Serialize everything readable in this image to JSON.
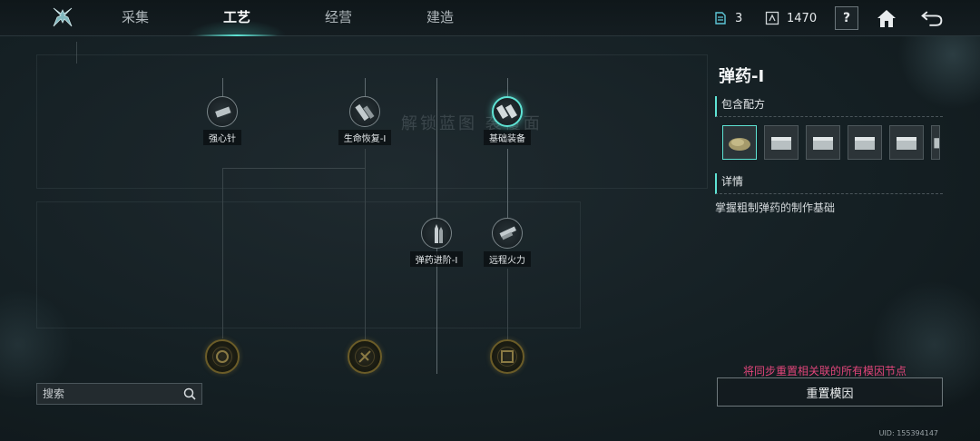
{
  "tabs": [
    {
      "label": "采集"
    },
    {
      "label": "工艺"
    },
    {
      "label": "经营"
    },
    {
      "label": "建造"
    }
  ],
  "resources": {
    "blueprint_count": "3",
    "currency": "1470"
  },
  "help_label": "?",
  "tree": {
    "watermark": "解锁蓝图    袭覆面",
    "nodes": [
      {
        "label": "强心针"
      },
      {
        "label": "生命恢复-I"
      },
      {
        "label": "基础装备"
      },
      {
        "label": "弹药进阶-I"
      },
      {
        "label": "远程火力"
      }
    ]
  },
  "search": {
    "placeholder": "搜索"
  },
  "panel": {
    "title": "弹药-I",
    "recipes_heading": "包含配方",
    "details_heading": "详情",
    "description": "掌握粗制弹药的制作基础",
    "warning": "将同步重置相关联的所有模因节点",
    "reset_label": "重置模因"
  },
  "uid": "UID: 155394147",
  "colors": {
    "accent": "#5ee3d4",
    "warning": "#e0457a",
    "bronze": "#6b5c28"
  }
}
